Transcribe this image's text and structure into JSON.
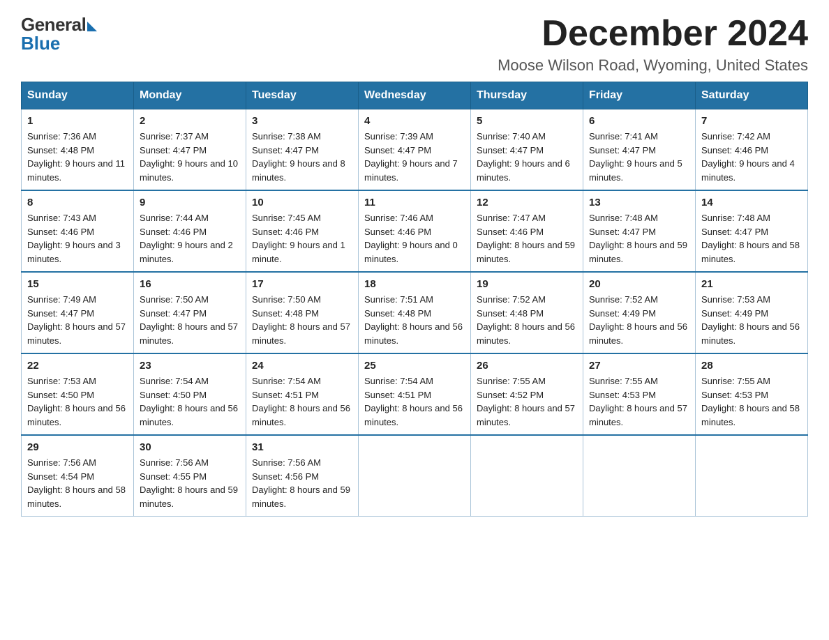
{
  "logo": {
    "general": "General",
    "blue": "Blue"
  },
  "header": {
    "title": "December 2024",
    "location": "Moose Wilson Road, Wyoming, United States"
  },
  "days_of_week": [
    "Sunday",
    "Monday",
    "Tuesday",
    "Wednesday",
    "Thursday",
    "Friday",
    "Saturday"
  ],
  "weeks": [
    [
      {
        "day": "1",
        "sunrise": "7:36 AM",
        "sunset": "4:48 PM",
        "daylight": "9 hours and 11 minutes."
      },
      {
        "day": "2",
        "sunrise": "7:37 AM",
        "sunset": "4:47 PM",
        "daylight": "9 hours and 10 minutes."
      },
      {
        "day": "3",
        "sunrise": "7:38 AM",
        "sunset": "4:47 PM",
        "daylight": "9 hours and 8 minutes."
      },
      {
        "day": "4",
        "sunrise": "7:39 AM",
        "sunset": "4:47 PM",
        "daylight": "9 hours and 7 minutes."
      },
      {
        "day": "5",
        "sunrise": "7:40 AM",
        "sunset": "4:47 PM",
        "daylight": "9 hours and 6 minutes."
      },
      {
        "day": "6",
        "sunrise": "7:41 AM",
        "sunset": "4:47 PM",
        "daylight": "9 hours and 5 minutes."
      },
      {
        "day": "7",
        "sunrise": "7:42 AM",
        "sunset": "4:46 PM",
        "daylight": "9 hours and 4 minutes."
      }
    ],
    [
      {
        "day": "8",
        "sunrise": "7:43 AM",
        "sunset": "4:46 PM",
        "daylight": "9 hours and 3 minutes."
      },
      {
        "day": "9",
        "sunrise": "7:44 AM",
        "sunset": "4:46 PM",
        "daylight": "9 hours and 2 minutes."
      },
      {
        "day": "10",
        "sunrise": "7:45 AM",
        "sunset": "4:46 PM",
        "daylight": "9 hours and 1 minute."
      },
      {
        "day": "11",
        "sunrise": "7:46 AM",
        "sunset": "4:46 PM",
        "daylight": "9 hours and 0 minutes."
      },
      {
        "day": "12",
        "sunrise": "7:47 AM",
        "sunset": "4:46 PM",
        "daylight": "8 hours and 59 minutes."
      },
      {
        "day": "13",
        "sunrise": "7:48 AM",
        "sunset": "4:47 PM",
        "daylight": "8 hours and 59 minutes."
      },
      {
        "day": "14",
        "sunrise": "7:48 AM",
        "sunset": "4:47 PM",
        "daylight": "8 hours and 58 minutes."
      }
    ],
    [
      {
        "day": "15",
        "sunrise": "7:49 AM",
        "sunset": "4:47 PM",
        "daylight": "8 hours and 57 minutes."
      },
      {
        "day": "16",
        "sunrise": "7:50 AM",
        "sunset": "4:47 PM",
        "daylight": "8 hours and 57 minutes."
      },
      {
        "day": "17",
        "sunrise": "7:50 AM",
        "sunset": "4:48 PM",
        "daylight": "8 hours and 57 minutes."
      },
      {
        "day": "18",
        "sunrise": "7:51 AM",
        "sunset": "4:48 PM",
        "daylight": "8 hours and 56 minutes."
      },
      {
        "day": "19",
        "sunrise": "7:52 AM",
        "sunset": "4:48 PM",
        "daylight": "8 hours and 56 minutes."
      },
      {
        "day": "20",
        "sunrise": "7:52 AM",
        "sunset": "4:49 PM",
        "daylight": "8 hours and 56 minutes."
      },
      {
        "day": "21",
        "sunrise": "7:53 AM",
        "sunset": "4:49 PM",
        "daylight": "8 hours and 56 minutes."
      }
    ],
    [
      {
        "day": "22",
        "sunrise": "7:53 AM",
        "sunset": "4:50 PM",
        "daylight": "8 hours and 56 minutes."
      },
      {
        "day": "23",
        "sunrise": "7:54 AM",
        "sunset": "4:50 PM",
        "daylight": "8 hours and 56 minutes."
      },
      {
        "day": "24",
        "sunrise": "7:54 AM",
        "sunset": "4:51 PM",
        "daylight": "8 hours and 56 minutes."
      },
      {
        "day": "25",
        "sunrise": "7:54 AM",
        "sunset": "4:51 PM",
        "daylight": "8 hours and 56 minutes."
      },
      {
        "day": "26",
        "sunrise": "7:55 AM",
        "sunset": "4:52 PM",
        "daylight": "8 hours and 57 minutes."
      },
      {
        "day": "27",
        "sunrise": "7:55 AM",
        "sunset": "4:53 PM",
        "daylight": "8 hours and 57 minutes."
      },
      {
        "day": "28",
        "sunrise": "7:55 AM",
        "sunset": "4:53 PM",
        "daylight": "8 hours and 58 minutes."
      }
    ],
    [
      {
        "day": "29",
        "sunrise": "7:56 AM",
        "sunset": "4:54 PM",
        "daylight": "8 hours and 58 minutes."
      },
      {
        "day": "30",
        "sunrise": "7:56 AM",
        "sunset": "4:55 PM",
        "daylight": "8 hours and 59 minutes."
      },
      {
        "day": "31",
        "sunrise": "7:56 AM",
        "sunset": "4:56 PM",
        "daylight": "8 hours and 59 minutes."
      },
      null,
      null,
      null,
      null
    ]
  ]
}
